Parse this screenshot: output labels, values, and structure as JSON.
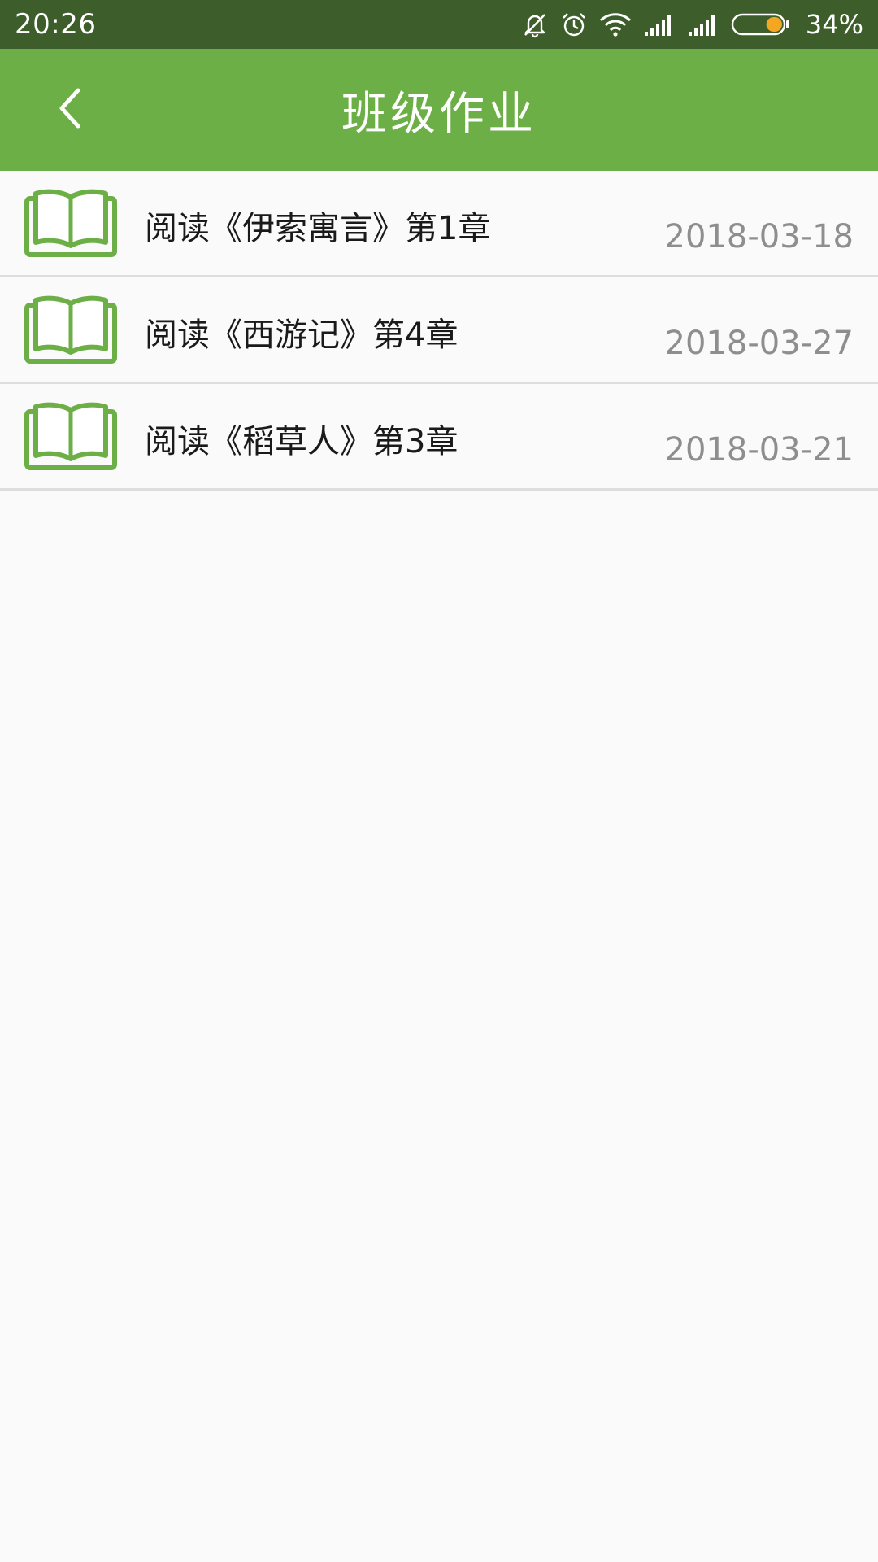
{
  "colors": {
    "status_bar": "#3d5e2a",
    "brand": "#6daf47",
    "battery_fill": "#f5a623"
  },
  "status_bar": {
    "time": "20:26",
    "battery_percent": "34%",
    "battery_level": 0.34,
    "icons": [
      "mute-bell-icon",
      "alarm-icon",
      "wifi-icon",
      "signal-icon",
      "signal-icon",
      "battery-icon"
    ]
  },
  "header": {
    "title": "班级作业",
    "back_icon": "chevron-left-icon"
  },
  "homework": {
    "items": [
      {
        "title": "阅读《伊索寓言》第1章",
        "date": "2018-03-18",
        "icon": "open-book-icon"
      },
      {
        "title": "阅读《西游记》第4章",
        "date": "2018-03-27",
        "icon": "open-book-icon"
      },
      {
        "title": "阅读《稻草人》第3章",
        "date": "2018-03-21",
        "icon": "open-book-icon"
      }
    ]
  }
}
